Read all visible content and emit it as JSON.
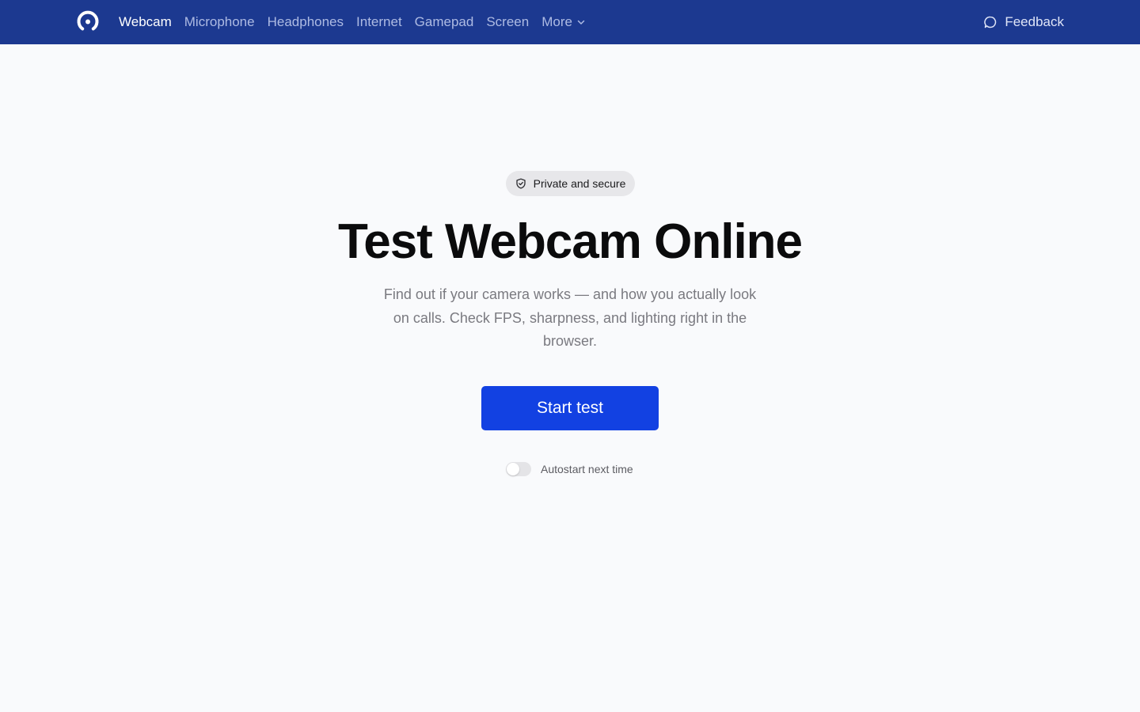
{
  "nav": {
    "items": [
      {
        "label": "Webcam",
        "active": true
      },
      {
        "label": "Microphone",
        "active": false
      },
      {
        "label": "Headphones",
        "active": false
      },
      {
        "label": "Internet",
        "active": false
      },
      {
        "label": "Gamepad",
        "active": false
      },
      {
        "label": "Screen",
        "active": false
      }
    ],
    "more_label": "More",
    "feedback_label": "Feedback"
  },
  "hero": {
    "badge_label": "Private and secure",
    "title": "Test Webcam Online",
    "subtitle": "Find out if your camera works — and how you actually look on calls. Check FPS, sharpness, and lighting right in the browser.",
    "start_button_label": "Start test",
    "autostart_label": "Autostart next time",
    "autostart_enabled": false
  },
  "colors": {
    "nav_background": "#1c3990",
    "nav_active_text": "#ffffff",
    "nav_inactive_text": "#aebbe3",
    "primary_button": "#1241e2",
    "page_background": "#f9fafc"
  },
  "icons": {
    "logo": "app-logo-icon",
    "more": "chevron-down-icon",
    "feedback": "chat-bubble-icon",
    "badge": "shield-check-icon"
  }
}
